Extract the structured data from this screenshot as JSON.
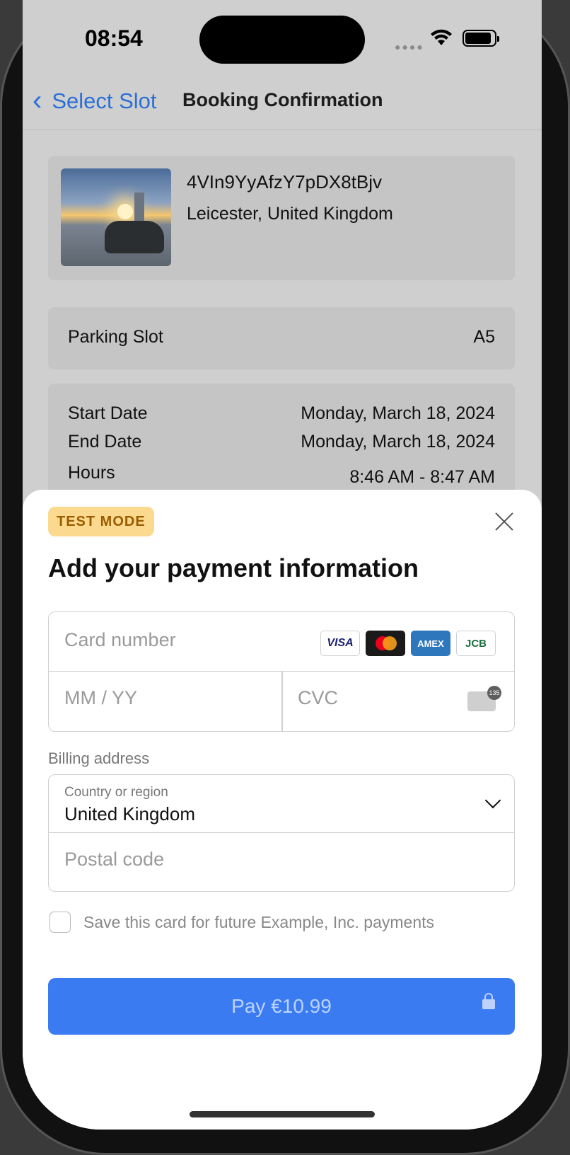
{
  "status": {
    "time": "08:54"
  },
  "nav": {
    "back_label": "Select Slot",
    "title": "Booking Confirmation"
  },
  "listing": {
    "name": "4VIn9YyAfzY7pDX8tBjv",
    "location": "Leicester, United Kingdom"
  },
  "slot": {
    "label": "Parking Slot",
    "value": "A5"
  },
  "dates": {
    "start_label": "Start Date",
    "start_value": "Monday, March 18, 2024",
    "end_label": "End Date",
    "end_value": "Monday, March 18, 2024",
    "hours_label": "Hours",
    "hours_value": "8:46 AM - 8:47 AM"
  },
  "payment": {
    "badge": "TEST MODE",
    "heading": "Add your payment information",
    "card_placeholder": "Card number",
    "expiry_placeholder": "MM / YY",
    "cvc_placeholder": "CVC",
    "cvc_icon_number": "135",
    "brands": [
      "VISA",
      "MasterCard",
      "AMEX",
      "JCB"
    ],
    "billing_label": "Billing address",
    "country_label": "Country or region",
    "country_value": "United Kingdom",
    "postal_placeholder": "Postal code",
    "save_label": "Save this card for future Example, Inc. payments",
    "pay_label": "Pay €10.99"
  },
  "colors": {
    "accent": "#3a7bf1",
    "badge_bg": "#fbd98f",
    "badge_text": "#9a5c00"
  }
}
